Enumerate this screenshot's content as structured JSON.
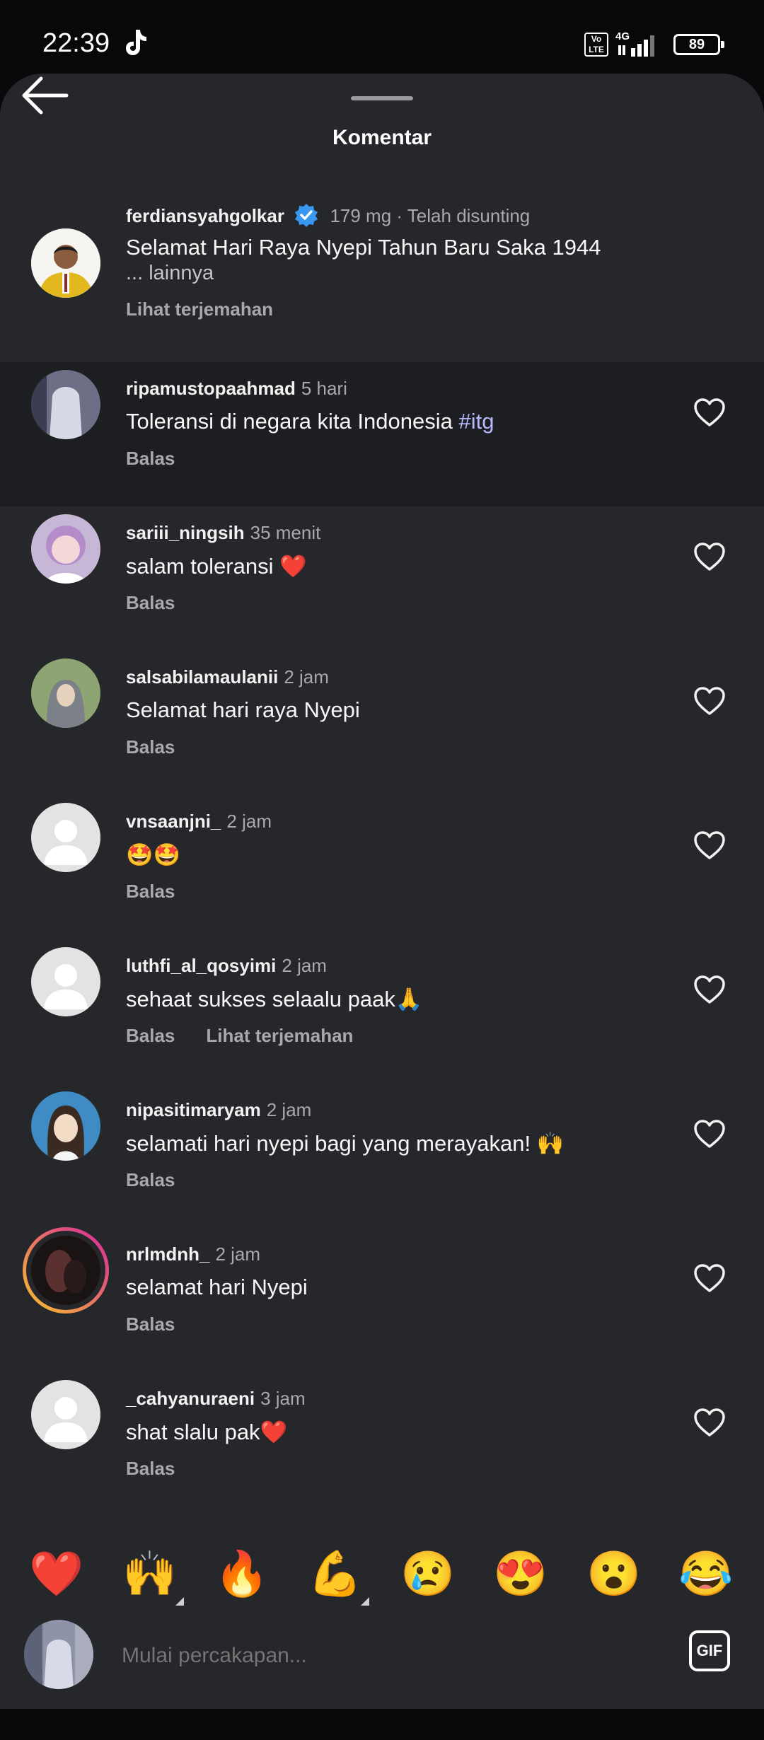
{
  "status_bar": {
    "time": "22:39",
    "network": "4G",
    "volte": "Vo LTE",
    "battery": "89"
  },
  "header": {
    "title": "Komentar"
  },
  "caption": {
    "username": "ferdiansyahgolkar",
    "meta": "179 mg · Telah disunting",
    "text": "Selamat Hari Raya Nyepi Tahun Baru Saka 1944",
    "more": "... lainnya",
    "translate": "Lihat terjemahan"
  },
  "comments": [
    {
      "username": "ripamustopaahmad",
      "time": "5 hari",
      "text": "Toleransi di negara kita Indonesia ",
      "hashtag": "#itg",
      "reply": "Balas",
      "translate": ""
    },
    {
      "username": "sariii_ningsih",
      "time": "35 menit",
      "text": "salam toleransi ❤️",
      "reply": "Balas",
      "translate": ""
    },
    {
      "username": "salsabilamaulanii",
      "time": "2 jam",
      "text": "Selamat hari raya Nyepi",
      "reply": "Balas",
      "translate": ""
    },
    {
      "username": "vnsaanjni_",
      "time": "2 jam",
      "text": "🤩🤩",
      "reply": "Balas",
      "translate": ""
    },
    {
      "username": "luthfi_al_qosyimi",
      "time": "2 jam",
      "text": "sehaat sukses selaalu paak🙏",
      "reply": "Balas",
      "translate": "Lihat terjemahan"
    },
    {
      "username": "nipasitimaryam",
      "time": "2 jam",
      "text": "selamati hari nyepi bagi yang merayakan! 🙌",
      "reply": "Balas",
      "translate": ""
    },
    {
      "username": "nrlmdnh_",
      "time": "2 jam",
      "text": "selamat hari Nyepi",
      "reply": "Balas",
      "translate": ""
    },
    {
      "username": "_cahyanuraeni",
      "time": "3 jam",
      "text": "shat slalu pak❤️",
      "reply": "Balas",
      "translate": ""
    }
  ],
  "reactions": [
    "❤️",
    "🙌",
    "🔥",
    "💪",
    "😢",
    "😍",
    "😮",
    "😂"
  ],
  "input": {
    "placeholder": "Mulai percakapan...",
    "gif_label": "GIF"
  },
  "colors": {
    "background": "#25272b",
    "highlight": "#1d1e21",
    "hashtag": "#b6b9ff",
    "verified": "#3897f0",
    "story_ring": [
      "#f9c32b",
      "#d6249f"
    ]
  }
}
